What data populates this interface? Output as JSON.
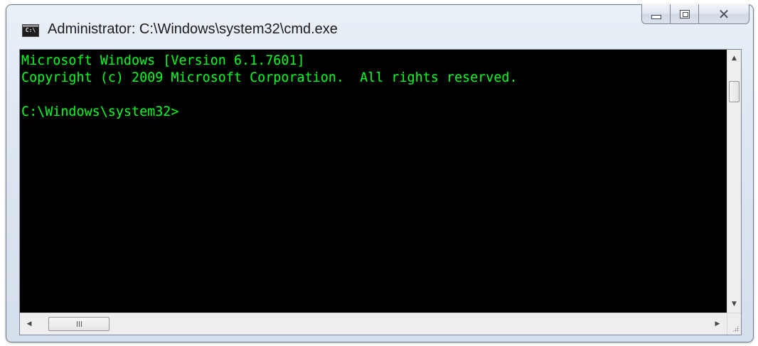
{
  "window": {
    "title": "Administrator: C:\\Windows\\system32\\cmd.exe",
    "app_icon_label": "C:\\",
    "app_icon": "console-icon",
    "caption_buttons": {
      "minimize_icon": "minimize-icon",
      "maximize_icon": "maximize-icon",
      "close_icon": "close-icon",
      "close_glyph": "✕"
    }
  },
  "console": {
    "lines": [
      "Microsoft Windows [Version 6.1.7601]",
      "Copyright (c) 2009 Microsoft Corporation.  All rights reserved.",
      "",
      "C:\\Windows\\system32>"
    ],
    "text_color": "#00ff20",
    "background_color": "#000000"
  },
  "scrollbars": {
    "up_arrow": "▲",
    "down_arrow": "▼",
    "left_arrow": "◀",
    "right_arrow": "▶"
  }
}
